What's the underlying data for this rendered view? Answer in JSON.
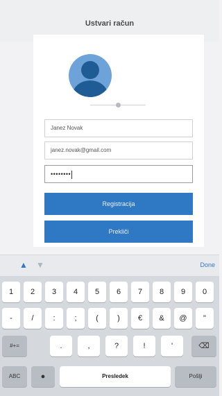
{
  "header": {
    "title": "Ustvari račun"
  },
  "form": {
    "name_value": "Janez Novak",
    "email_value": "janez.novak@gmail.com",
    "password_mask": "••••••••"
  },
  "buttons": {
    "register_label": "Registracija",
    "login_label": "Prekliči"
  },
  "accessory": {
    "done_label": "Done"
  },
  "keyboard": {
    "row1": [
      "1",
      "2",
      "3",
      "4",
      "5",
      "6",
      "7",
      "8",
      "9",
      "0"
    ],
    "row2": [
      "-",
      "/",
      ":",
      ";",
      "(",
      ")",
      "€",
      "&",
      "@",
      "\""
    ],
    "row3_left": "#+=",
    "row3": [
      ".",
      ",",
      "?",
      "!",
      "'"
    ],
    "row4_abc": "ABC",
    "space_label": "Presledek",
    "return_label": "Pošlji"
  }
}
